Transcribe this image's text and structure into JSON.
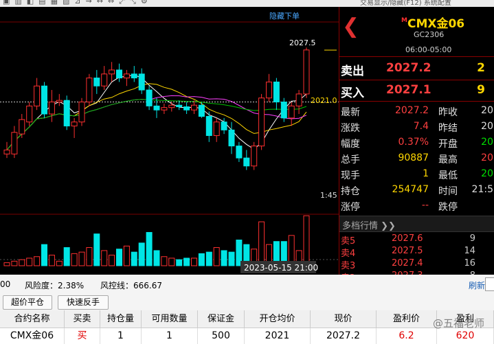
{
  "toolbar": {
    "icons": [
      "chart-icon",
      "indicator-icon",
      "line-icon",
      "draw-icon",
      "zoom-icon",
      "arrow-icon",
      "cursor-icon",
      "expand-left-icon",
      "expand-right-icon",
      "arrows-icon",
      "tools-icon"
    ],
    "right_text": "交易显示/隐藏(F12)      系统配置"
  },
  "chart": {
    "hide_order_label": "隐藏下单",
    "high_label": "2027.5",
    "mark_price": "2021.0",
    "time_label": "1:45",
    "datetime_label": "2023-05-15 21:00",
    "colors": {
      "up": "#ff3030",
      "down": "#00e5e5",
      "ma1": "#ffffff",
      "ma2": "#ffd700",
      "ma3": "#ff40ff",
      "ma4": "#00c000"
    },
    "candles": [
      {
        "o": 2014.5,
        "h": 2016.0,
        "l": 2014.0,
        "c": 2015.0,
        "v": 2
      },
      {
        "o": 2014.5,
        "h": 2018.0,
        "l": 2014.0,
        "c": 2017.2,
        "v": 3
      },
      {
        "o": 2017.0,
        "h": 2019.5,
        "l": 2016.5,
        "c": 2018.8,
        "v": 4
      },
      {
        "o": 2018.5,
        "h": 2021.0,
        "l": 2018.0,
        "c": 2020.5,
        "v": 5
      },
      {
        "o": 2020.5,
        "h": 2024.0,
        "l": 2020.0,
        "c": 2023.0,
        "v": 6
      },
      {
        "o": 2023.0,
        "h": 2023.5,
        "l": 2019.0,
        "c": 2019.5,
        "v": 14
      },
      {
        "o": 2019.5,
        "h": 2022.5,
        "l": 2018.5,
        "c": 2021.0,
        "v": 7
      },
      {
        "o": 2021.0,
        "h": 2022.0,
        "l": 2020.5,
        "c": 2021.2,
        "v": 3
      },
      {
        "o": 2021.2,
        "h": 2021.8,
        "l": 2017.5,
        "c": 2018.0,
        "v": 12
      },
      {
        "o": 2018.0,
        "h": 2019.0,
        "l": 2016.5,
        "c": 2018.5,
        "v": 8
      },
      {
        "o": 2018.5,
        "h": 2021.5,
        "l": 2018.0,
        "c": 2021.0,
        "v": 9
      },
      {
        "o": 2021.0,
        "h": 2024.5,
        "l": 2020.5,
        "c": 2024.0,
        "v": 12
      },
      {
        "o": 2024.0,
        "h": 2025.0,
        "l": 2022.0,
        "c": 2023.0,
        "v": 21
      },
      {
        "o": 2023.0,
        "h": 2025.5,
        "l": 2022.5,
        "c": 2024.5,
        "v": 10
      },
      {
        "o": 2024.5,
        "h": 2026.0,
        "l": 2023.5,
        "c": 2025.0,
        "v": 7
      },
      {
        "o": 2025.0,
        "h": 2025.8,
        "l": 2023.5,
        "c": 2024.0,
        "v": 11
      },
      {
        "o": 2024.0,
        "h": 2025.0,
        "l": 2023.0,
        "c": 2024.5,
        "v": 13
      },
      {
        "o": 2024.5,
        "h": 2025.5,
        "l": 2023.5,
        "c": 2024.0,
        "v": 9
      },
      {
        "o": 2024.5,
        "h": 2025.2,
        "l": 2022.0,
        "c": 2022.5,
        "v": 15
      },
      {
        "o": 2022.5,
        "h": 2023.0,
        "l": 2020.0,
        "c": 2020.5,
        "v": 22
      },
      {
        "o": 2020.5,
        "h": 2021.5,
        "l": 2019.0,
        "c": 2020.0,
        "v": 10
      },
      {
        "o": 2020.0,
        "h": 2020.8,
        "l": 2019.5,
        "c": 2020.3,
        "v": 6
      },
      {
        "o": 2020.3,
        "h": 2021.0,
        "l": 2019.8,
        "c": 2020.6,
        "v": 5
      },
      {
        "o": 2020.6,
        "h": 2021.2,
        "l": 2020.0,
        "c": 2020.4,
        "v": 4
      },
      {
        "o": 2020.4,
        "h": 2021.0,
        "l": 2019.5,
        "c": 2020.0,
        "v": 5
      },
      {
        "o": 2020.0,
        "h": 2021.2,
        "l": 2019.5,
        "c": 2020.6,
        "v": 5
      },
      {
        "o": 2020.6,
        "h": 2021.0,
        "l": 2019.0,
        "c": 2019.2,
        "v": 8
      },
      {
        "o": 2019.2,
        "h": 2019.8,
        "l": 2016.0,
        "c": 2016.8,
        "v": 9
      },
      {
        "o": 2016.8,
        "h": 2019.0,
        "l": 2016.0,
        "c": 2018.5,
        "v": 12
      },
      {
        "o": 2018.5,
        "h": 2019.0,
        "l": 2017.0,
        "c": 2017.5,
        "v": 10
      },
      {
        "o": 2017.5,
        "h": 2018.5,
        "l": 2014.5,
        "c": 2015.5,
        "v": 9
      },
      {
        "o": 2015.5,
        "h": 2016.0,
        "l": 2013.5,
        "c": 2014.0,
        "v": 17
      },
      {
        "o": 2014.0,
        "h": 2015.0,
        "l": 2012.5,
        "c": 2013.0,
        "v": 14
      },
      {
        "o": 2013.0,
        "h": 2016.0,
        "l": 2012.5,
        "c": 2015.5,
        "v": 11
      },
      {
        "o": 2015.5,
        "h": 2022.0,
        "l": 2015.0,
        "c": 2021.5,
        "v": 29
      },
      {
        "o": 2021.5,
        "h": 2024.5,
        "l": 2021.0,
        "c": 2023.5,
        "v": 14
      },
      {
        "o": 2023.5,
        "h": 2024.0,
        "l": 2020.0,
        "c": 2021.0,
        "v": 16
      },
      {
        "o": 2021.0,
        "h": 2021.5,
        "l": 2018.5,
        "c": 2019.0,
        "v": 16
      },
      {
        "o": 2019.0,
        "h": 2021.0,
        "l": 2018.0,
        "c": 2020.5,
        "v": 20
      },
      {
        "o": 2020.5,
        "h": 2022.5,
        "l": 2019.5,
        "c": 2022.0,
        "v": 10
      },
      {
        "o": 2022.0,
        "h": 2027.8,
        "l": 2021.5,
        "c": 2027.5,
        "v": 33
      }
    ]
  },
  "symbol": {
    "back_glyph": "❮",
    "marker": "M",
    "name": "CMX金06",
    "code": "GC2306",
    "hours": "06:00-05:00"
  },
  "quote": {
    "ask_label": "卖出",
    "ask_price": "2027.2",
    "ask_qty": "2",
    "bid_label": "买入",
    "bid_price": "2027.1",
    "bid_qty": "9"
  },
  "stats_left": [
    {
      "label": "最新",
      "value": "2027.2",
      "color": "#ff4040"
    },
    {
      "label": "涨跌",
      "value": "7.4",
      "color": "#ff4040"
    },
    {
      "label": "幅度",
      "value": "0.37%",
      "color": "#ff4040"
    },
    {
      "label": "总手",
      "value": "90887",
      "color": "#ffd700"
    },
    {
      "label": "现手",
      "value": "1",
      "color": "#ffd700"
    },
    {
      "label": "持仓",
      "value": "254747",
      "color": "#ffd700"
    },
    {
      "label": "涨停",
      "value": "--",
      "color": "#ff4040"
    }
  ],
  "stats_right": [
    {
      "label": "昨收",
      "value": "20",
      "color": "#e0e0e0"
    },
    {
      "label": "昨结",
      "value": "20",
      "color": "#e0e0e0"
    },
    {
      "label": "开盘",
      "value": "20",
      "color": "#00e000"
    },
    {
      "label": "最高",
      "value": "20",
      "color": "#ff4040"
    },
    {
      "label": "最低",
      "value": "20",
      "color": "#00e000"
    },
    {
      "label": "时间",
      "value": "21:5",
      "color": "#e0e0e0"
    },
    {
      "label": "跌停",
      "value": "",
      "color": "#e0e0e0"
    }
  ],
  "depth": {
    "title": "多档行情 ❯❯",
    "rows": [
      {
        "side": "卖5",
        "price": "2027.6",
        "qty": "9"
      },
      {
        "side": "卖4",
        "price": "2027.5",
        "qty": "14"
      },
      {
        "side": "卖3",
        "price": "2027.4",
        "qty": "16"
      },
      {
        "side": "卖2",
        "price": "2027.3",
        "qty": "8"
      }
    ]
  },
  "account": {
    "balance_partial": "00",
    "risk_label": "风险度：2.38%",
    "liquidation_label": "风控线：666.67",
    "refresh_label": "刷新"
  },
  "buttons": {
    "over_price_close": "超价平仓",
    "quick_reverse": "快速反手"
  },
  "positions": {
    "headers": [
      "合约名称",
      "买卖",
      "持仓量",
      "可用数量",
      "保证金",
      "开仓均价",
      "现价",
      "盈利价",
      "盈利"
    ],
    "rows": [
      {
        "contract": "CMX金06",
        "side": "买",
        "qty": "1",
        "available": "1",
        "margin": "500",
        "open_avg": "2021",
        "price": "2027.2",
        "profit_pts": "6.2",
        "profit": "620"
      }
    ]
  },
  "watermark": "@五福老师"
}
